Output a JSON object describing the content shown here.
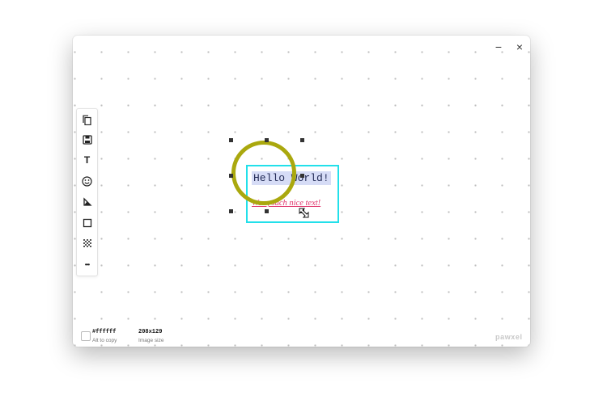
{
  "window": {
    "minimize_label": "−",
    "close_label": "×"
  },
  "toolbar": {
    "items": [
      {
        "name": "copy-icon"
      },
      {
        "name": "save-icon"
      },
      {
        "name": "text-tool-icon",
        "glyph": "T"
      },
      {
        "name": "emoji-icon"
      },
      {
        "name": "line-tool-icon"
      },
      {
        "name": "rectangle-tool-icon"
      },
      {
        "name": "pixelate-tool-icon"
      },
      {
        "name": "more-icon",
        "glyph": "•••"
      }
    ]
  },
  "canvas": {
    "hello_text": "Hello World!",
    "wow_text": "Wow, such nice text!",
    "circle_color": "#aaa80e",
    "box_color": "#22e0ea",
    "wow_color": "#e0356c"
  },
  "status": {
    "color_hex": "#ffffff",
    "color_hint": "Alt to copy",
    "image_size": "208x129",
    "size_hint": "Image size"
  },
  "brand": "pawxel"
}
